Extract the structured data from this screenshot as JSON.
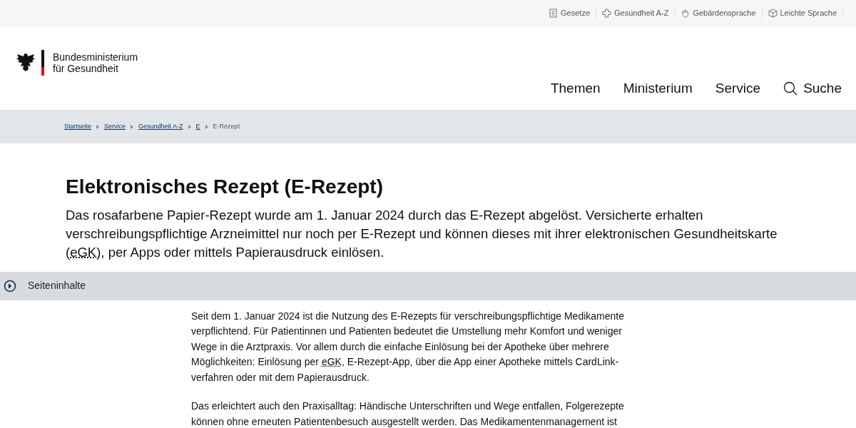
{
  "service_links": [
    {
      "label": "Gesetze"
    },
    {
      "label": "Gesundheit A-Z"
    },
    {
      "label": "Gebärdensprache"
    },
    {
      "label": "Leichte Sprache"
    }
  ],
  "logo": {
    "line1": "Bundesministerium",
    "line2": "für Gesundheit"
  },
  "nav": [
    {
      "label": "Themen"
    },
    {
      "label": "Ministerium"
    },
    {
      "label": "Service"
    },
    {
      "label": "Suche",
      "kind": "search"
    }
  ],
  "breadcrumb": [
    {
      "label": "Startseite",
      "current": false
    },
    {
      "label": "Service",
      "current": false
    },
    {
      "label": "Gesundheit A-Z",
      "current": false
    },
    {
      "label": "E",
      "current": false
    },
    {
      "label": "E-Rezept",
      "current": true
    }
  ],
  "title": "Elektronisches Rezept (E-Rezept)",
  "intro": [
    {
      "kind": "text",
      "text": "Das rosafarbene Papier-Rezept wurde am 1. Januar 2024 durch das E-Rezept abgelöst. Versicherte erhalten verschreibungspflichtige Arzneimittel nur noch per E-Rezept und können dieses mit ihrer elektronischen Gesundheitskarte ("
    },
    {
      "kind": "abbr",
      "text": "eGK"
    },
    {
      "kind": "text",
      "text": "), per Apps oder mittels Papierausdruck einlösen."
    }
  ],
  "toc": {
    "label": "Seiteninhalte",
    "expanded": false
  },
  "paragraphs": [
    [
      {
        "kind": "text",
        "text": "Seit dem 1. Januar 2024 ist die Nutzung des E-Rezepts für verschreibungspflichtige Medikamente verpflichtend. Für Patientinnen und Patienten bedeutet die Umstellung mehr Komfort und weniger Wege in die Arztpraxis. Vor allem durch die einfache Einlösung bei der Apotheke über mehrere Möglichkeiten: Einlösung per "
      },
      {
        "kind": "abbr",
        "text": "eGK"
      },
      {
        "kind": "text",
        "text": ", E-Rezept-App, über die App einer Apotheke mittels CardLink-verfahren oder mit dem Papierausdruck."
      }
    ],
    [
      {
        "kind": "text",
        "text": "Das erleichtert auch den Praxisalltag: Händische Unterschriften und Wege entfallen, Folgerezepte können ohne erneuten Patientenbesuch ausgestellt werden. Das Medikamentenmanagement ist"
      }
    ]
  ]
}
